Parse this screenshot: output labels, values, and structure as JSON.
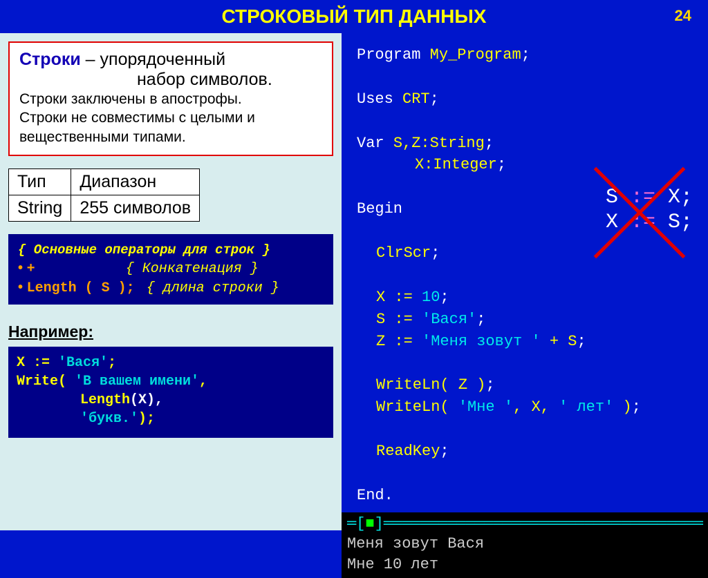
{
  "header": {
    "title": "СТРОКОВЫЙ ТИП ДАННЫХ",
    "page": "24"
  },
  "definition": {
    "term": "Строки",
    "l1_rest": " – упорядоченный",
    "l2": "набор символов.",
    "l3": "Строки заключены в апострофы.",
    "l4": "Строки не совместимы с целыми и",
    "l5": "вещественными типами."
  },
  "type_table": {
    "h1": "Тип",
    "h2": "Диапазон",
    "c1": "String",
    "c2": "255 символов"
  },
  "ops": {
    "title": "{ Основные операторы для строк }",
    "r1_sym": "+",
    "r1_comm": "{ Конкатенация }",
    "r2_sym": "Length ( S );",
    "r2_comm": "{ длина строки }"
  },
  "example": {
    "label": "Например:",
    "l1a": "X := ",
    "l1b": "'Вася'",
    "l1c": ";",
    "l2a": "Write( ",
    "l2b": "'В вашем имени'",
    "l2c": ",",
    "l3a": "Length",
    "l3b": "(X),",
    "l4a": "'букв.'",
    "l4b": ");"
  },
  "code": {
    "program": "Program",
    "prog_name": "My_Program",
    "uses": "Uses",
    "crt": "CRT",
    "var": "Var",
    "vars1": "S,Z:String",
    "vars2": "X:Integer",
    "begin": "Begin",
    "clr": "ClrScr",
    "a1a": "X := ",
    "a1b": "10",
    "a2a": "S := ",
    "a2b": "'Вася'",
    "a3a": "Z := ",
    "a3b": "'Меня зовут '",
    "a3c": " + S",
    "w1": "WriteLn( Z )",
    "w2a": "WriteLn( ",
    "w2b": "'Мне '",
    "w2c": ", X, ",
    "w2d": "' лет'",
    "w2e": " )",
    "rk": "ReadKey",
    "end": "End"
  },
  "error": {
    "l1a": "S ",
    "l1b": ":=",
    "l1c": " X;",
    "l2a": "X ",
    "l2b": ":=",
    "l2c": " S;"
  },
  "console": {
    "l1": "Меня зовут Вася",
    "l2": "Мне 10 лет"
  }
}
